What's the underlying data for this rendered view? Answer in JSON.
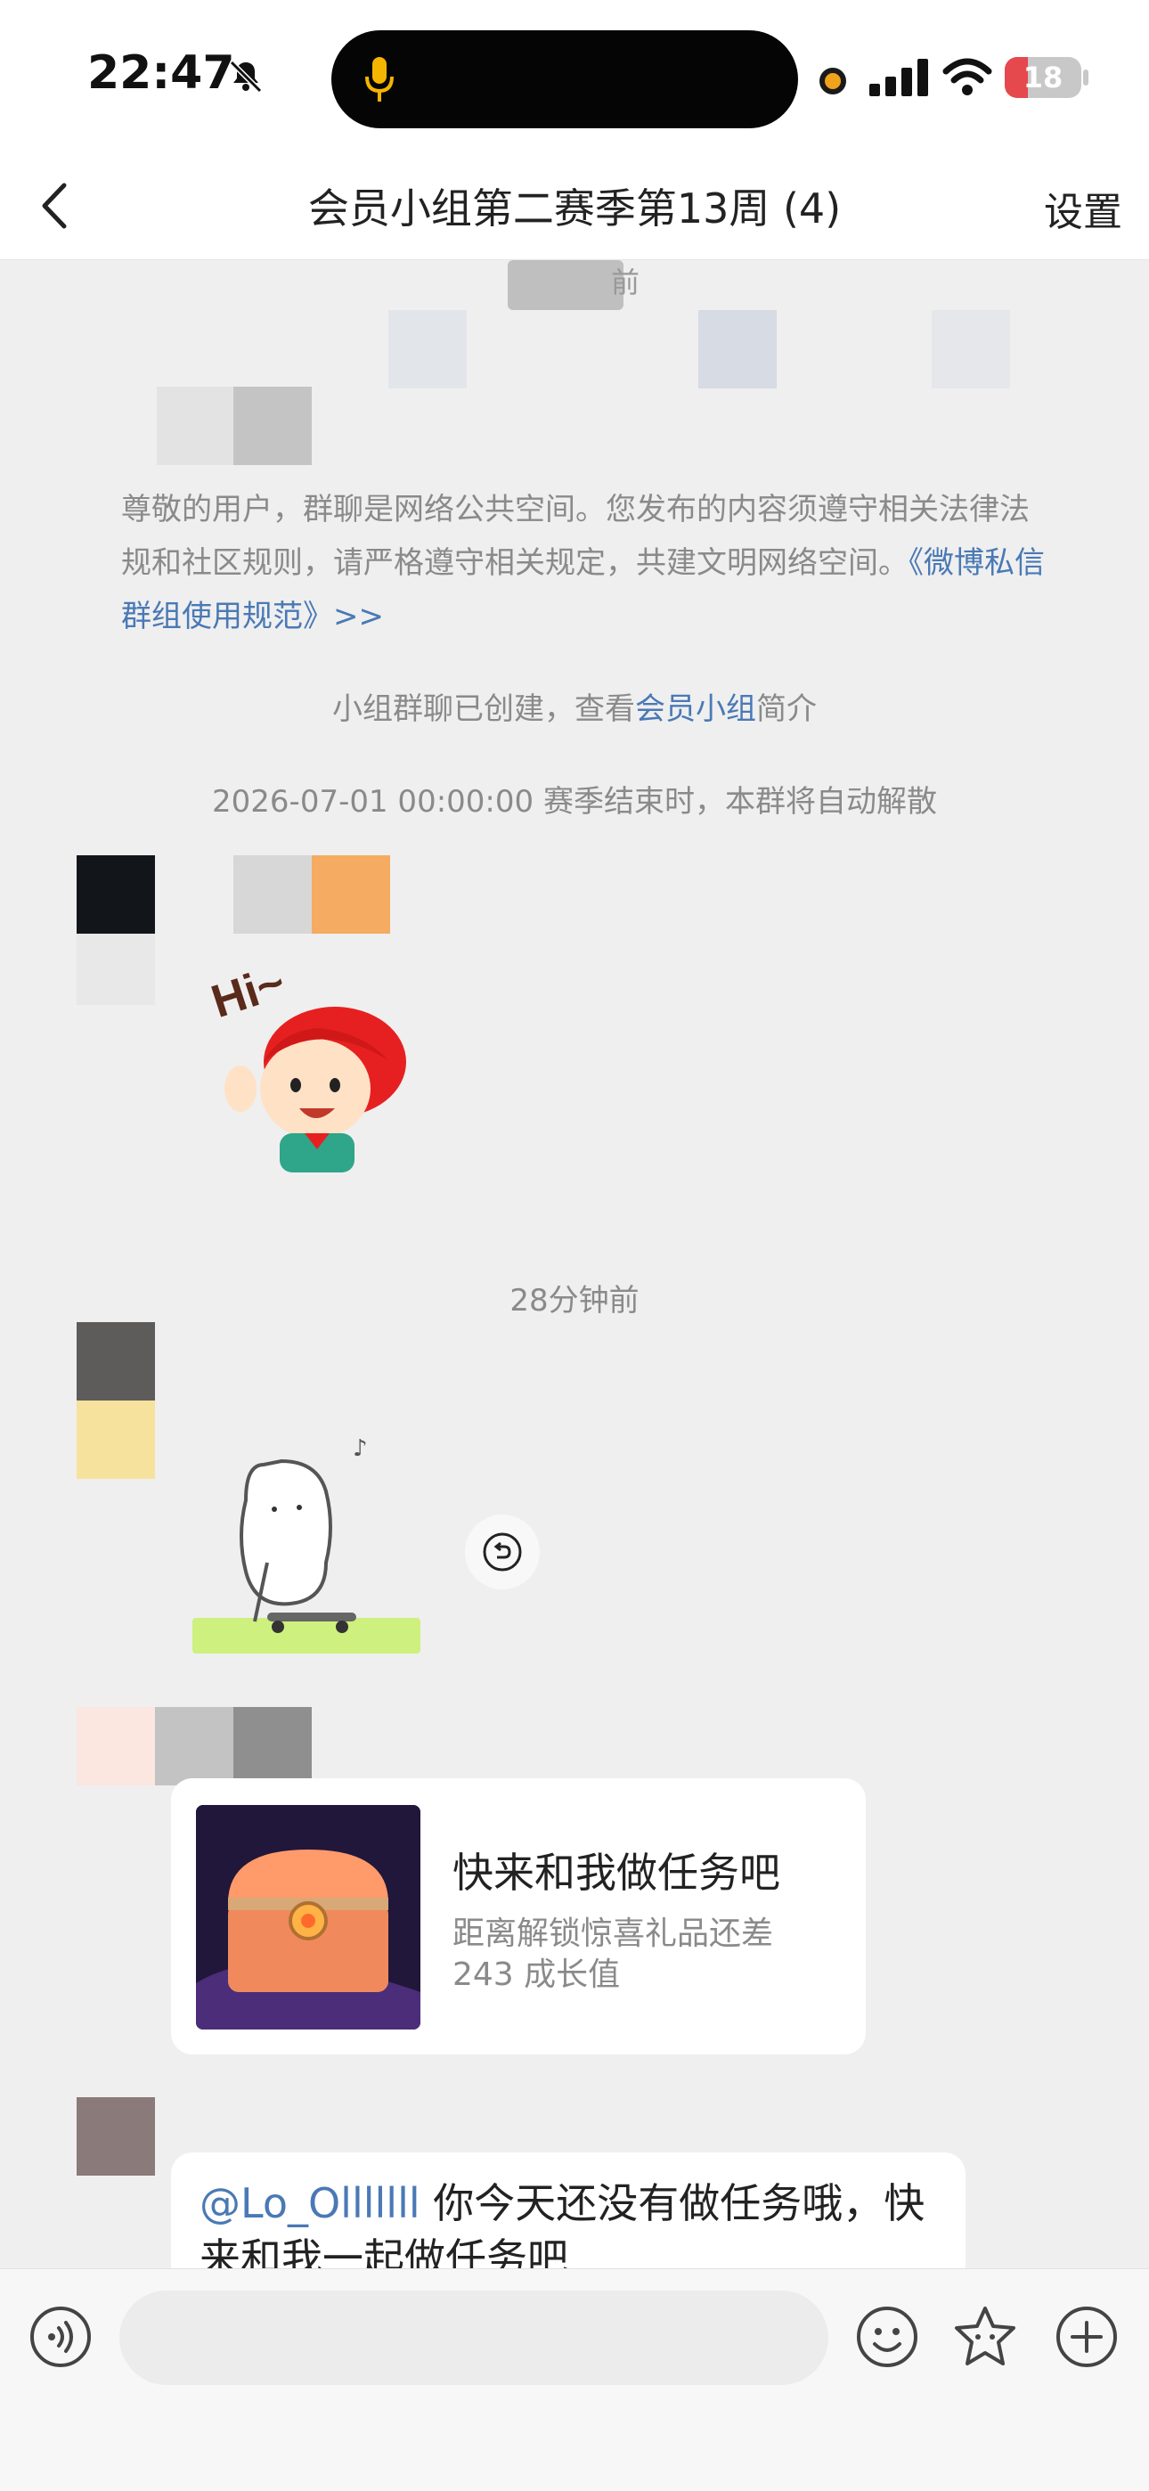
{
  "status_bar": {
    "time": "22:47",
    "battery_level": "18",
    "icons": [
      "bell-muted-icon",
      "mic-icon",
      "recording-dot-icon",
      "signal-icon",
      "wifi-icon",
      "battery-icon"
    ]
  },
  "nav": {
    "back_icon": "chevron-left-icon",
    "title": "会员小组第二赛季第13周 (4)",
    "settings_label": "设置"
  },
  "chat": {
    "top_time_suffix": "前",
    "notice_text": "尊敬的用户，群聊是网络公共空间。您发布的内容须遵守相关法律法规和社区规则，请严格遵守相关规定，共建文明网络空间。",
    "notice_link": "《微博私信群组使用规范》>>",
    "group_created_prefix": "小组群聊已创建，查看",
    "group_created_link": "会员小组",
    "group_created_suffix": "简介",
    "season_end_text": "2026-07-01 00:00:00 赛季结束时，本群将自动解散",
    "sticker_hi_text": "Hi~",
    "timestamp_28": "28分钟前",
    "task_card": {
      "title": "快来和我做任务吧",
      "desc": "距离解锁惊喜礼品还差 243 成长值"
    },
    "message": {
      "mention": "@Lo_Olllllll",
      "text": " 你今天还没有做任务哦，快来和我一起做任务吧"
    }
  },
  "input_bar": {
    "placeholder": "",
    "icons": [
      "voice-icon",
      "emoji-icon",
      "sticker-icon",
      "plus-icon"
    ]
  },
  "colors": {
    "link": "#4a79b5",
    "background": "#efefef",
    "battery_red": "#e5484d"
  }
}
